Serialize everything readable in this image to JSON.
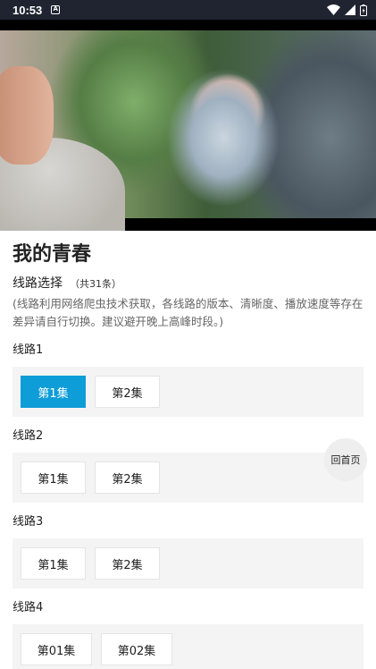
{
  "status_bar": {
    "time": "10:53",
    "notification_icon": "A",
    "icons": [
      "wifi-icon",
      "signal-icon",
      "battery-icon"
    ]
  },
  "video": {
    "description_icon": "video-player"
  },
  "title": "我的青春",
  "route_select_label": "线路选择",
  "route_count": "（共31条）",
  "notice": "(线路利用网络爬虫技术获取，各线路的版本、清晰度、播放速度等存在差异请自行切换。建议避开晚上高峰时段。)",
  "lines": [
    {
      "label": "线路1",
      "episodes": [
        "第1集",
        "第2集"
      ]
    },
    {
      "label": "线路2",
      "episodes": [
        "第1集",
        "第2集"
      ]
    },
    {
      "label": "线路3",
      "episodes": [
        "第1集",
        "第2集"
      ]
    },
    {
      "label": "线路4",
      "episodes": [
        "第01集",
        "第02集"
      ]
    }
  ],
  "active_episode": {
    "line": 1,
    "episode": 1
  },
  "home_button_label": "回首页",
  "colors": {
    "accent": "#0f9dd8",
    "panel": "#f4f4f4",
    "status_bar": "#1f2430"
  }
}
